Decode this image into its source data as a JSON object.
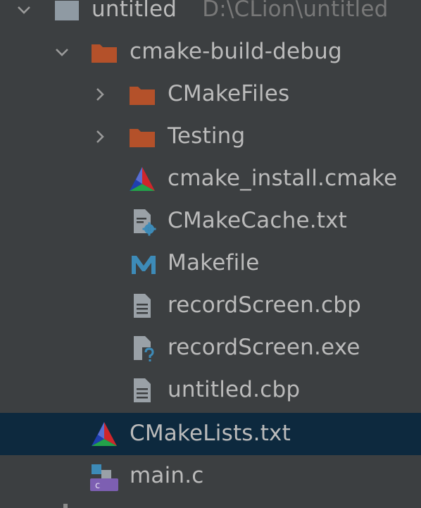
{
  "project": {
    "root_name": "untitled",
    "root_path": "D:\\CLion\\untitled"
  },
  "tree": {
    "build_dir": "cmake-build-debug",
    "items": [
      {
        "label": "CMakeFiles",
        "icon": "folder-icon"
      },
      {
        "label": "Testing",
        "icon": "folder-icon"
      },
      {
        "label": "cmake_install.cmake",
        "icon": "cmake-icon"
      },
      {
        "label": "CMakeCache.txt",
        "icon": "cmake-cache-icon"
      },
      {
        "label": "Makefile",
        "icon": "makefile-icon"
      },
      {
        "label": "recordScreen.cbp",
        "icon": "text-file-icon"
      },
      {
        "label": "recordScreen.exe",
        "icon": "unknown-file-icon"
      },
      {
        "label": "untitled.cbp",
        "icon": "text-file-icon"
      }
    ],
    "cmakelists": "CMakeLists.txt",
    "main": "main.c"
  },
  "colors": {
    "background": "#3c3f41",
    "selection": "#0d293e",
    "folder": "#b4512a",
    "text": "#bbbbbb",
    "hint": "#787878",
    "makefile": "#3d8bb8"
  }
}
